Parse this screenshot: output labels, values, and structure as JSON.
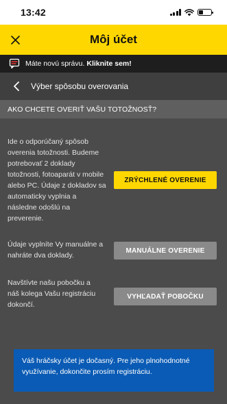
{
  "status_bar": {
    "time": "13:42"
  },
  "header": {
    "title": "Môj účet",
    "close_icon": "close-icon"
  },
  "message_bar": {
    "text": "Máte novú správu.",
    "link": "Kliknite sem!",
    "icon": "message-icon"
  },
  "sub_header": {
    "title": "Výber spôsobu overovania",
    "back_icon": "chevron-left-icon"
  },
  "question": "AKO CHCETE OVERIŤ VAŠU TOTOŽNOSŤ?",
  "options": [
    {
      "description": "Ide o odporúčaný spôsob overenia totožnosti. Budeme potrebovať 2 doklady totožnosti, fotoaparát v mobile alebo PC. Údaje z dokladov sa automaticky vyplnia a následne odošlú na preverenie.",
      "button": "ZRÝCHLENÉ OVERENIE"
    },
    {
      "description": "Údaje vyplníte Vy manuálne a nahráte dva doklady.",
      "button": "MANUÁLNE OVERENIE"
    },
    {
      "description": "Navštívte našu pobočku a náš kolega Vašu registráciu dokončí.",
      "button": "VYHĽADAŤ POBOČKU"
    }
  ],
  "info": "Váš hráčsky účet je dočasný. Pre jeho plnohodnotné využívanie, dokončite prosím registráciu.",
  "colors": {
    "accent": "#ffd700",
    "info_bg": "#0a5bb5",
    "background": "#4b4b4b",
    "secondary_button": "#8a8a8a"
  }
}
